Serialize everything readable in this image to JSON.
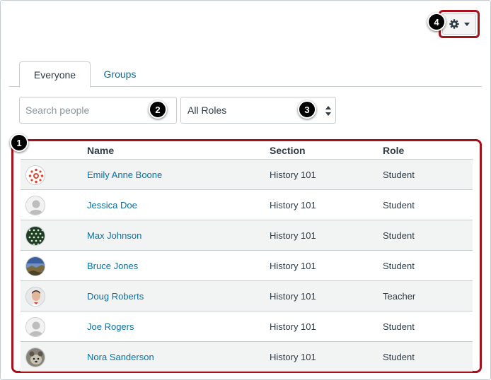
{
  "toolbar": {
    "settings_icon": "gear-icon",
    "dropdown_icon": "caret-down-icon"
  },
  "callouts": [
    "1",
    "2",
    "3",
    "4"
  ],
  "tabs": [
    {
      "label": "Everyone",
      "active": true
    },
    {
      "label": "Groups",
      "active": false
    }
  ],
  "search": {
    "placeholder": "Search people",
    "value": ""
  },
  "role_filter": {
    "selected": "All Roles"
  },
  "table": {
    "columns": [
      "Name",
      "Section",
      "Role"
    ],
    "rows": [
      {
        "name": "Emily Anne Boone",
        "section": "History 101",
        "role": "Student",
        "avatar": "canvas-logo-avatar"
      },
      {
        "name": "Jessica Doe",
        "section": "History 101",
        "role": "Student",
        "avatar": "default-avatar"
      },
      {
        "name": "Max Johnson",
        "section": "History 101",
        "role": "Student",
        "avatar": "pattern-avatar"
      },
      {
        "name": "Bruce Jones",
        "section": "History 101",
        "role": "Student",
        "avatar": "landscape-avatar"
      },
      {
        "name": "Doug Roberts",
        "section": "History 101",
        "role": "Teacher",
        "avatar": "photo-avatar"
      },
      {
        "name": "Joe Rogers",
        "section": "History 101",
        "role": "Student",
        "avatar": "default-avatar"
      },
      {
        "name": "Nora Sanderson",
        "section": "History 101",
        "role": "Student",
        "avatar": "animal-photo-avatar"
      }
    ]
  },
  "colors": {
    "link": "#0770a3",
    "highlight": "#a8111b",
    "row_alt": "#f2f4f4"
  }
}
